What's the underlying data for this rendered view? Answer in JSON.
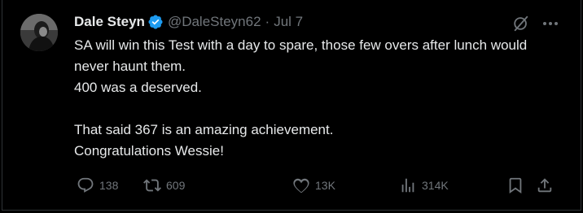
{
  "tweet": {
    "author_name": "Dale Steyn",
    "handle": "@DaleSteyn62",
    "separator": "·",
    "date": "Jul 7",
    "verified_color": "#1d9bf0",
    "text": "SA will win this Test with a day to spare, those few overs after lunch would never haunt them.\n400 was a deserved.\n\n That said 367 is an amazing achievement.\nCongratulations Wessie!"
  },
  "actions": {
    "replies": "138",
    "reposts": "609",
    "likes": "13K",
    "views": "314K"
  },
  "icons": {
    "avatar": "avatar-photo",
    "verified": "verified-badge-icon",
    "grok": "grok-icon",
    "more": "more-icon",
    "reply": "reply-icon",
    "repost": "repost-icon",
    "like": "heart-icon",
    "views": "views-chart-icon",
    "bookmark": "bookmark-icon",
    "share": "share-icon"
  }
}
